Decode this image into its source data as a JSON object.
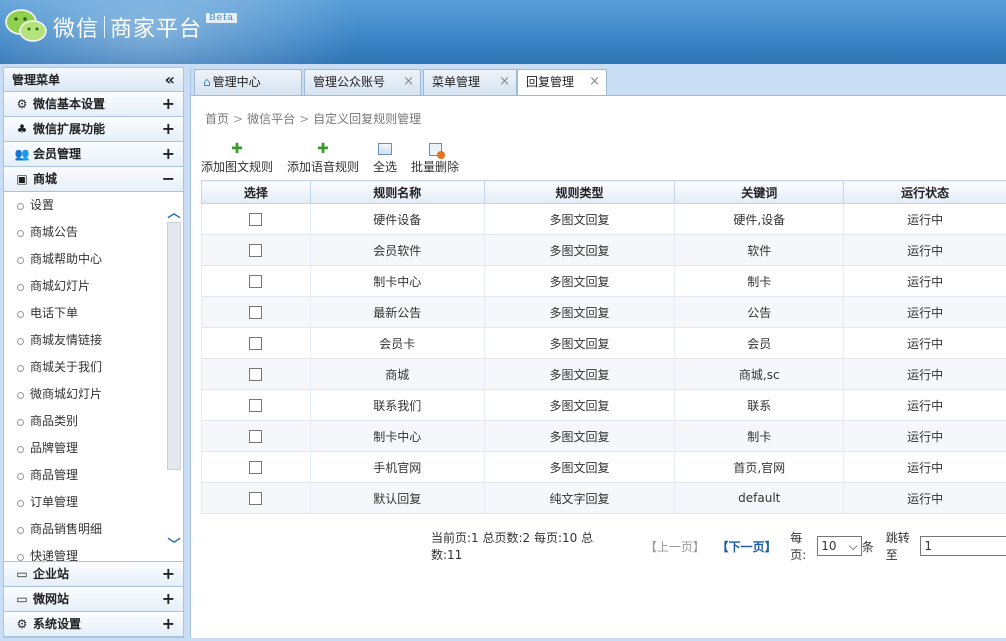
{
  "header": {
    "app_name": "微信",
    "platform_name": "商家平台",
    "badge": "Beta"
  },
  "sidebar": {
    "title": "管理菜单",
    "collapse_glyph": "«",
    "groups_top": [
      {
        "label": "微信基本设置",
        "icon": "gear-icon",
        "toggle": "+"
      },
      {
        "label": "微信扩展功能",
        "icon": "leaf-icon",
        "toggle": "+"
      },
      {
        "label": "会员管理",
        "icon": "users-icon",
        "toggle": "+"
      },
      {
        "label": "商城",
        "icon": "shop-icon",
        "toggle": "−"
      }
    ],
    "shop_items": [
      "设置",
      "商城公告",
      "商城帮助中心",
      "商城幻灯片",
      "电话下单",
      "商城友情链接",
      "商城关于我们",
      "微商城幻灯片",
      "商品类别",
      "品牌管理",
      "商品管理",
      "订单管理",
      "商品销售明细",
      "快递管理"
    ],
    "groups_bottom": [
      {
        "label": "企业站",
        "icon": "monitor-icon",
        "toggle": "+"
      },
      {
        "label": "微网站",
        "icon": "monitor-icon",
        "toggle": "+"
      },
      {
        "label": "系统设置",
        "icon": "gear-icon",
        "toggle": "+"
      }
    ]
  },
  "tabs": [
    {
      "label": "管理中心",
      "closable": false
    },
    {
      "label": "管理公众账号",
      "closable": true
    },
    {
      "label": "菜单管理",
      "closable": true
    },
    {
      "label": "回复管理",
      "closable": true,
      "active": true
    }
  ],
  "close_glyph": "×",
  "breadcrumb": [
    "首页",
    "微信平台",
    "自定义回复规则管理"
  ],
  "breadcrumb_sep": ">",
  "toolbar": {
    "add_news": "添加图文规则",
    "add_voice": "添加语音规则",
    "select_all": "全选",
    "batch_delete": "批量删除"
  },
  "table": {
    "columns": [
      "选择",
      "规则名称",
      "规则类型",
      "关键词",
      "运行状态"
    ],
    "rows": [
      {
        "name": "硬件设备",
        "type": "多图文回复",
        "keyword": "硬件,设备",
        "status": "运行中"
      },
      {
        "name": "会员软件",
        "type": "多图文回复",
        "keyword": "软件",
        "status": "运行中"
      },
      {
        "name": "制卡中心",
        "type": "多图文回复",
        "keyword": "制卡",
        "status": "运行中"
      },
      {
        "name": "最新公告",
        "type": "多图文回复",
        "keyword": "公告",
        "status": "运行中"
      },
      {
        "name": "会员卡",
        "type": "多图文回复",
        "keyword": "会员",
        "status": "运行中"
      },
      {
        "name": "商城",
        "type": "多图文回复",
        "keyword": "商城,sc",
        "status": "运行中"
      },
      {
        "name": "联系我们",
        "type": "多图文回复",
        "keyword": "联系",
        "status": "运行中"
      },
      {
        "name": "制卡中心",
        "type": "多图文回复",
        "keyword": "制卡",
        "status": "运行中"
      },
      {
        "name": "手机官网",
        "type": "多图文回复",
        "keyword": "首页,官网",
        "status": "运行中"
      },
      {
        "name": "默认回复",
        "type": "纯文字回复",
        "keyword": "default",
        "status": "运行中"
      }
    ]
  },
  "pager": {
    "summary": "当前页:1 总页数:2 每页:10 总数:11",
    "prev": "【上一页】",
    "next": "【下一页】",
    "per_page_label": "每页:",
    "per_page_value": "10",
    "per_page_unit": "条",
    "jump_label": "跳转至",
    "jump_value": "1"
  },
  "colors": {
    "header_blue": "#3c85c6",
    "panel_bg": "#c9def4",
    "link_blue": "#1c5ea8"
  }
}
